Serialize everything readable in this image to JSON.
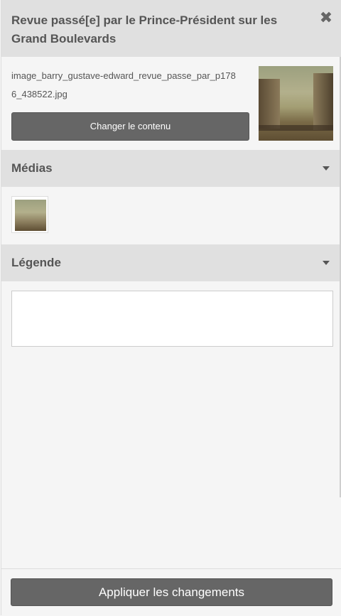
{
  "header": {
    "title": "Revue passé[e] par le Prince-Président sur les Grand Boulevards",
    "close_icon": "close-icon"
  },
  "file": {
    "filename": "image_barry_gustave-edward_revue_passe_par_p1786_438522.jpg",
    "change_button_label": "Changer le contenu"
  },
  "medias": {
    "label": "Médias",
    "icon": "caret-down-icon"
  },
  "legend": {
    "label": "Légende",
    "icon": "caret-down-icon",
    "value": ""
  },
  "footer": {
    "apply_button_label": "Appliquer les changements"
  }
}
